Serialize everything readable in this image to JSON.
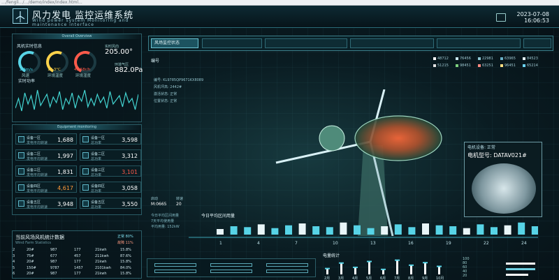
{
  "browser": {
    "url": "…/fengli.../…/demo/index/index.html..."
  },
  "header": {
    "title": "风力发电 监控运维系统",
    "subtitle": "Wind power system Monitoring and maintenance interface",
    "date": "2023-07-08",
    "time": "16:06:53"
  },
  "overview": {
    "panel_title": "Overall Overview",
    "section_title": "风机实时信息",
    "gauges": [
      {
        "value": "2.2m/s",
        "label": "风速",
        "color": "#3fd0e6"
      },
      {
        "value": "17.3°C",
        "label": "环境温度",
        "color": "#ffd24a"
      },
      {
        "value": "42.58r/h",
        "label": "环境湿度",
        "color": "#ff5a4a"
      }
    ],
    "gauge_caption": "实时功率",
    "power_label": "实时风向",
    "power_value": "205.00°",
    "pressure_label": "环境气压",
    "pressure_value": "882.0Pa",
    "wave_values": [
      5,
      12,
      3,
      16,
      8,
      14,
      4,
      18,
      7,
      11,
      15,
      6,
      13,
      9,
      17,
      4,
      12,
      8,
      16,
      5,
      14,
      10,
      18,
      6,
      12,
      7,
      15,
      9,
      13,
      5,
      17,
      8,
      11,
      14,
      6,
      16,
      9,
      12,
      4,
      15
    ]
  },
  "equipment": {
    "panel_title": "Equipment monitoring",
    "rows": [
      {
        "name": "设备一区",
        "sub": "发电平均转速",
        "value": "1,688",
        "color": "#ffffff"
      },
      {
        "name": "设备一区",
        "sub": "总功率",
        "value": "3,598",
        "color": "#ffffff"
      },
      {
        "name": "设备二区",
        "sub": "发电平均转速",
        "value": "1,997",
        "color": "#ffffff"
      },
      {
        "name": "设备二区",
        "sub": "总功率",
        "value": "3,312",
        "color": "#ffffff"
      },
      {
        "name": "设备三区",
        "sub": "发电平均转速",
        "value": "1,831",
        "color": "#ffffff"
      },
      {
        "name": "设备三区",
        "sub": "总功率",
        "value": "3,101",
        "color": "#ff5a4a"
      },
      {
        "name": "设备四区",
        "sub": "发电平均转速",
        "value": "4,617",
        "color": "#ff9a3a"
      },
      {
        "name": "设备四区",
        "sub": "总功率",
        "value": "3,058",
        "color": "#ffffff"
      },
      {
        "name": "设备五区",
        "sub": "发电平均转速",
        "value": "3,948",
        "color": "#ffffff"
      },
      {
        "name": "设备五区",
        "sub": "总功率",
        "value": "3,550",
        "color": "#ffffff"
      }
    ]
  },
  "stats": {
    "title": "当前风场风机统计数据",
    "sub_title": "Wind Farm Statistics",
    "badge_1": "正常 80%",
    "badge_2": "故障 11%",
    "rows": [
      [
        "2",
        "20#",
        "987",
        "177",
        "21kwh",
        "15.8%"
      ],
      [
        "3",
        "75#",
        "677",
        "457",
        "211kwh",
        "87.6%"
      ],
      [
        "4",
        "20#",
        "987",
        "177",
        "21kwh",
        "15.8%"
      ],
      [
        "5",
        "150#",
        "9787",
        "1457",
        "2101kwh",
        "84.0%"
      ],
      [
        "6",
        "20#",
        "987",
        "177",
        "21kwh",
        "15.8%"
      ]
    ]
  },
  "monitor": {
    "tab_label": "风场监控状态",
    "fan_label": "编号",
    "legend": [
      {
        "label": "48712",
        "color": "#ffffff"
      },
      {
        "label": "76456",
        "color": "#c9e6ee"
      },
      {
        "label": "22981",
        "color": "#8ec6d4"
      },
      {
        "label": "63965",
        "color": "#68b0c7"
      },
      {
        "label": "84523",
        "color": "#e6f4f8"
      },
      {
        "label": "51215",
        "color": "#e2e2e2"
      },
      {
        "label": "98451",
        "color": "#7fd27f"
      },
      {
        "label": "63251",
        "color": "#ff8a80"
      },
      {
        "label": "96451",
        "color": "#ffe082"
      },
      {
        "label": "65214",
        "color": "#6bd3f3"
      }
    ],
    "info_lines": [
      "编号: KL9785QP9671KX8089",
      "风机坪高: 2442#",
      "激活状态: 正常",
      "位置状态: 正常"
    ],
    "lower_info": [
      "启动",
      "转速",
      "M:0665",
      "20"
    ],
    "timeline": [
      "今日平均区间用量",
      "7天平均使用量",
      "平均用量: 152kW"
    ]
  },
  "motor": {
    "status": "电机设备: 正常",
    "model": "电机型号: DATAV021#"
  },
  "hour_chart": {
    "title": "今日平均区间用量",
    "ticks": [
      "1",
      "4",
      "7",
      "10",
      "13",
      "16",
      "19",
      "22",
      "24"
    ],
    "values": [
      6,
      9,
      8,
      11,
      7,
      10,
      12,
      9,
      8,
      13,
      10,
      7,
      9,
      11,
      8,
      12,
      10,
      9,
      7,
      11,
      8,
      10,
      13,
      9
    ]
  },
  "power_chart": {
    "title": "电量统计",
    "months": [
      "2月",
      "3月",
      "4月",
      "5月",
      "6月",
      "7月",
      "8月",
      "9月",
      "10月"
    ],
    "values": [
      35,
      68,
      42,
      77,
      30,
      85,
      55,
      70,
      48
    ],
    "ylim": [
      0,
      100
    ],
    "yticks": [
      "100",
      "80",
      "60",
      "40",
      "20"
    ]
  }
}
